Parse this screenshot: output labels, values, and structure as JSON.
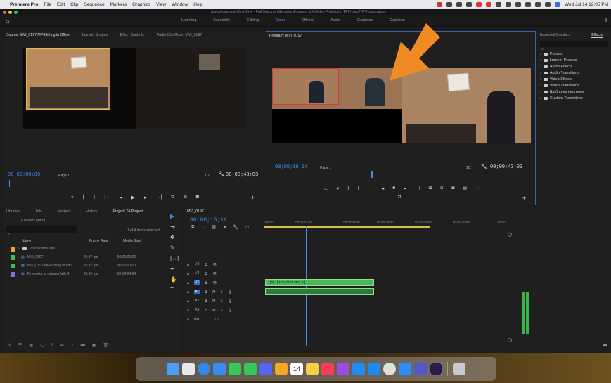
{
  "menubar": {
    "app_name": "Premiere Pro",
    "items": [
      "File",
      "Edit",
      "Clip",
      "Sequence",
      "Markers",
      "Graphics",
      "View",
      "Window",
      "Help"
    ],
    "datetime": "Wed Jul 14  12:05 PM"
  },
  "titlebar": {
    "document_path": "/Users/calebelay/OneDrive - Full Spectrum Behavior Analysis, LLC/Video Projects/1. TA Project/TA Project.prproj"
  },
  "workspaces": {
    "tabs": [
      "Learning",
      "Assembly",
      "Editing",
      "Color",
      "Effects",
      "Audio",
      "Graphics",
      "Captions"
    ],
    "active": "Color"
  },
  "source_panel": {
    "tabs": [
      "Source: MVI_0197.MP4Sitting in Office",
      "Lumetri Scopes",
      "Effect Controls",
      "Audio Clip Mixer: MVI_0197"
    ],
    "timecode_in": "00;00;00;00",
    "page_label": "Page 1",
    "zoom": "1/2",
    "duration": "00;00;43;03"
  },
  "program_panel": {
    "tab": "Program: MVI_0197",
    "timecode": "00;00;16;14",
    "page_label": "Page 1",
    "zoom": "1/2",
    "duration": "00;00;43;03"
  },
  "effects_panel": {
    "tabs": [
      "Essential Graphics",
      "Effects"
    ],
    "items": [
      "Presets",
      "Lumetri Presets",
      "Audio Effects",
      "Audio Transitions",
      "Video Effects",
      "Video Transitions",
      "Шаблоны настроек",
      "Custom Transitions"
    ]
  },
  "project_panel": {
    "tabs": [
      "Libraries",
      "Info",
      "Markers",
      "History",
      "Project: TA Project"
    ],
    "project_file": "TA Project.prproj",
    "selection_info": "1 of 4 items selected",
    "columns": [
      "Name",
      "Frame Rate",
      "Media Start"
    ],
    "rows": [
      {
        "name": "Processed Clips",
        "fps": "",
        "start": "",
        "color": "#e8a33a",
        "kind": "bin"
      },
      {
        "name": "MVI_0197",
        "fps": "29.97 fps",
        "start": "00;00;00;00",
        "color": "#3fbf5a",
        "kind": "sequence"
      },
      {
        "name": "MVI_0197.MP4Sitting in Offi",
        "fps": "29.97 fps",
        "start": "00;00;00;00",
        "color": "#3fbf5a",
        "kind": "clip"
      },
      {
        "name": "Fireworks at niagara falls 4",
        "fps": "30.00 fps",
        "start": "00;14;04;04",
        "color": "#7e6ee0",
        "kind": "clip"
      }
    ]
  },
  "timeline": {
    "tab": "MVI_0197",
    "timecode": "00;00;16;16",
    "ruler_ticks": [
      ";00;00",
      "00;00;16;00",
      "00;00;32;00",
      "00;00;48;00",
      "00;01;04;02",
      "00;01;20;02",
      "00;01"
    ],
    "tracks": [
      "V3",
      "V2",
      "V1",
      "A1",
      "A2",
      "A3",
      "Mix"
    ],
    "mix_value": "0.0",
    "clip_label": "[90,1] MVI_0197.MP4 [V]"
  },
  "colors": {
    "accent": "#3d8df5",
    "panel_bg": "#1f1f1f",
    "clip_green": "#4cb857",
    "arrow": "#f08a25"
  }
}
